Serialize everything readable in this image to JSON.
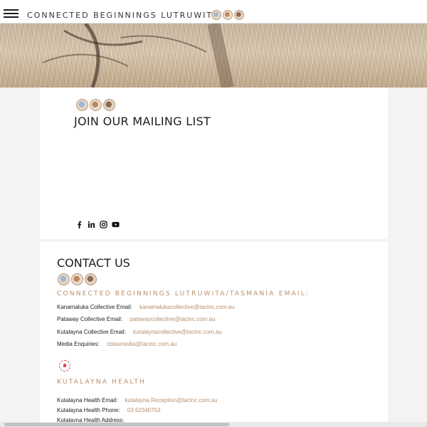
{
  "header": {
    "site_title": "CONNECTED BEGINNINGS LUTRUWITA",
    "menu_icon": "hamburger-menu-icon",
    "badge_icons": [
      "badge-blue-icon",
      "badge-orange-icon",
      "badge-brown-icon"
    ]
  },
  "mailing": {
    "title": "JOIN OUR MAILING LIST",
    "social_icons": [
      "facebook-icon",
      "linkedin-icon",
      "instagram-icon",
      "youtube-icon"
    ]
  },
  "contact": {
    "title": "CONTACT US",
    "email_heading": "CONNECTED BEGINNINGS LUTRUWITA/TASMANIA EMAIL:",
    "email_rows": [
      {
        "label": "Kanamaluka Collective Email:",
        "value": "kanamalukacollective@tacinc.com.au"
      },
      {
        "label": "Pataway Collective Email:",
        "value": "patawaycollective@tacinc.com.au"
      },
      {
        "label": "Kutalayna Collective Email:",
        "value": "kutalaynacollective@tacinc.com.au"
      },
      {
        "label": "Media Enquiries:",
        "value": "cbtasmedia@tacinc.com.au"
      }
    ],
    "health_heading": "KUTALAYNA HEALTH",
    "health_rows": [
      {
        "label": "Kutalayna Health Email:",
        "value": "kutalayna.Reception@tacinc.com.au"
      },
      {
        "label": "Kutalayna Health Phone:",
        "value": "03 62340753"
      },
      {
        "label": "Kutalayna Health Address:",
        "value": ""
      }
    ]
  },
  "colors": {
    "accent": "#b88f6c",
    "text": "#1e1e1e",
    "background": "#f3f3f3",
    "card": "#ffffff"
  }
}
